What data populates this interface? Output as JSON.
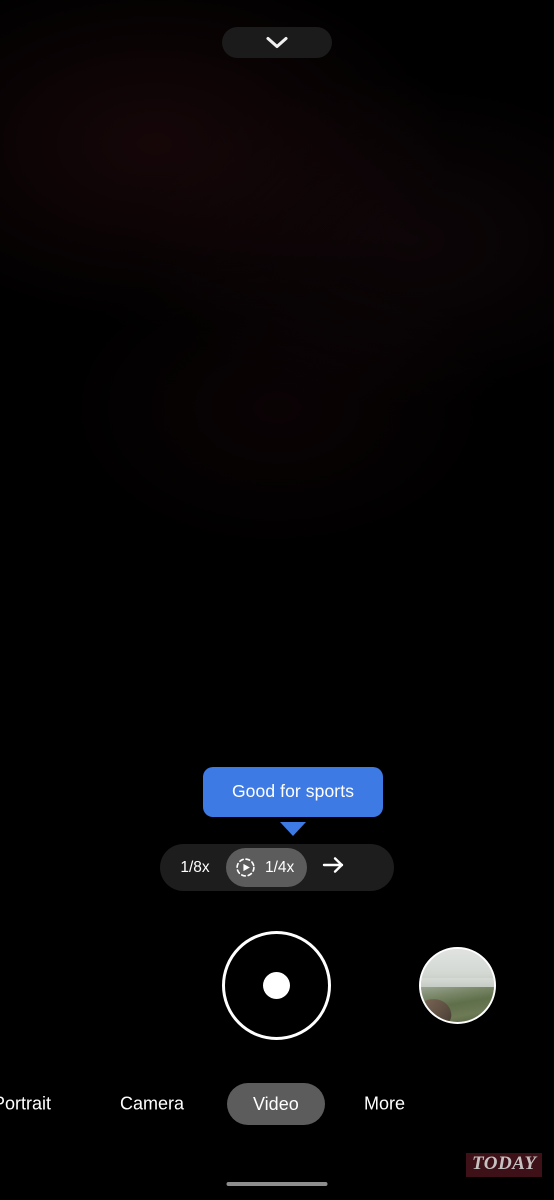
{
  "app": {
    "name": "Camera",
    "background_color": "#000000"
  },
  "top_bar": {
    "collapse_button": {
      "icon": "chevron-down-icon",
      "label": "",
      "background_color": "#1b1b1b"
    }
  },
  "viewfinder": {
    "state": "dark-preview",
    "description": ""
  },
  "tooltip": {
    "text": "Good for sports",
    "background_color": "#3d7ae4",
    "text_color": "#ffffff",
    "pointer": "down"
  },
  "speed_selector": {
    "background_color": "#1d1d1d",
    "selected_background_color": "#5c5c5c",
    "options": [
      {
        "label": "1/8x",
        "selected": false,
        "icon": ""
      },
      {
        "label": "1/4x",
        "selected": true,
        "icon": "slow-motion-icon"
      }
    ],
    "next_button": {
      "icon": "arrow-right-icon",
      "label": ""
    }
  },
  "capture": {
    "shutter_button": {
      "label": "",
      "icon": "record-shutter-icon",
      "color": "#ffffff"
    },
    "gallery_thumbnail": {
      "label": "",
      "icon": "gallery-thumbnail"
    }
  },
  "modes": {
    "items": [
      {
        "label": "Portrait",
        "selected": false
      },
      {
        "label": "Camera",
        "selected": false
      },
      {
        "label": "Video",
        "selected": true
      },
      {
        "label": "More",
        "selected": false
      }
    ],
    "selected_pill_color": "#5c5c5c"
  },
  "watermark": {
    "text": "TODAY",
    "background_color": "#3d1117",
    "text_color": "#c6c2c2"
  },
  "system": {
    "home_indicator": {
      "color": "#8d8d8d"
    }
  }
}
